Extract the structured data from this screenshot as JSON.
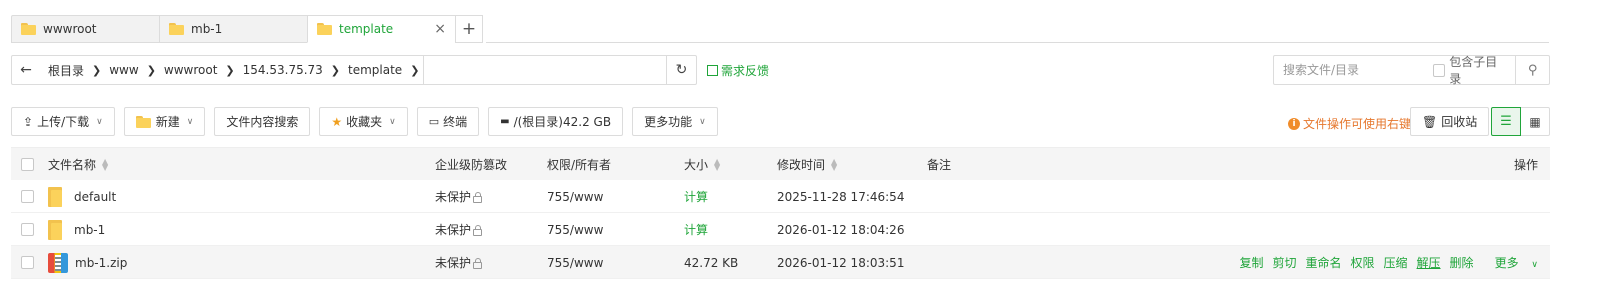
{
  "tabs": [
    {
      "label": "wwwroot",
      "active": false
    },
    {
      "label": "mb-1",
      "active": false
    },
    {
      "label": "template",
      "active": true
    }
  ],
  "pathbar": {
    "crumbs": [
      "根目录",
      "www",
      "wwwroot",
      "154.53.75.73",
      "template"
    ]
  },
  "feedback_label": "需求反馈",
  "search": {
    "placeholder": "搜索文件/目录",
    "include_sub_label": "包含子目录"
  },
  "toolbar": {
    "upload_label": "上传/下载",
    "new_label": "新建",
    "content_search_label": "文件内容搜索",
    "favorites_label": "收藏夹",
    "terminal_label": "终端",
    "disk_label": "/(根目录)42.2 GB",
    "more_label": "更多功能",
    "tip_label": "文件操作可使用右键",
    "recycle_label": "回收站"
  },
  "table": {
    "headers": {
      "name": "文件名称",
      "protect": "企业级防篡改",
      "perm": "权限/所有者",
      "size": "大小",
      "mtime": "修改时间",
      "note": "备注",
      "op": "操作"
    },
    "rows": [
      {
        "name": "default",
        "type": "folder",
        "protect": "未保护",
        "perm": "755/www",
        "size": "计算",
        "mtime": "2025-11-28 17:46:54"
      },
      {
        "name": "mb-1",
        "type": "folder",
        "protect": "未保护",
        "perm": "755/www",
        "size": "计算",
        "mtime": "2026-01-12 18:04:26"
      },
      {
        "name": "mb-1.zip",
        "type": "zip",
        "protect": "未保护",
        "perm": "755/www",
        "size": "42.72 KB",
        "mtime": "2026-01-12 18:03:51"
      }
    ],
    "row_actions": [
      "复制",
      "剪切",
      "重命名",
      "权限",
      "压缩",
      "解压",
      "删除",
      "更多"
    ]
  },
  "colors": {
    "accent": "#20a53a",
    "warning": "#e6772d"
  }
}
